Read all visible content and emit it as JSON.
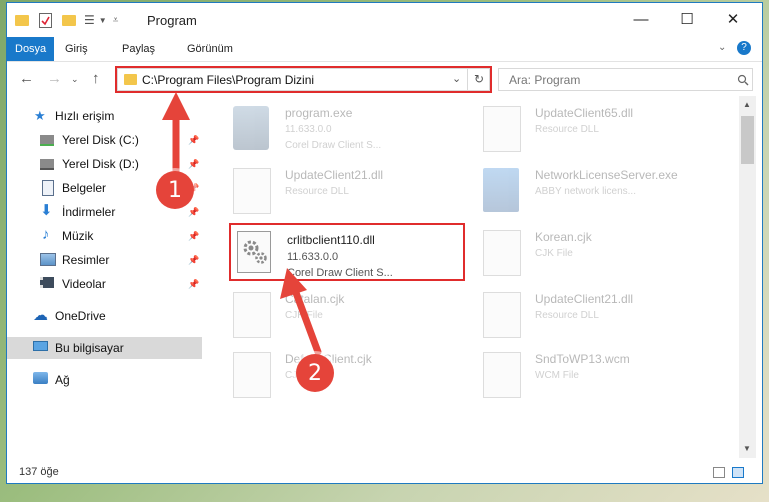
{
  "window": {
    "title": "Program",
    "controls": {
      "minimize": "—",
      "maximize": "☐",
      "close": "✕"
    }
  },
  "ribbon": {
    "tabs": [
      {
        "label": "Dosya",
        "active": true
      },
      {
        "label": "Giriş"
      },
      {
        "label": "Paylaş"
      },
      {
        "label": "Görünüm"
      }
    ],
    "accent": "#1979ca"
  },
  "address": {
    "path": "C:\\Program Files\\Program Dizini"
  },
  "search": {
    "placeholder": "Ara: Program"
  },
  "sidebar": {
    "items": [
      {
        "label": "Hızlı erişim",
        "icon": "star-icon"
      },
      {
        "label": "Yerel Disk (C:)",
        "icon": "drive-icon",
        "pinned": true
      },
      {
        "label": "Yerel Disk (D:)",
        "icon": "drive-icon",
        "pinned": true
      },
      {
        "label": "Belgeler",
        "icon": "documents-icon",
        "pinned": true
      },
      {
        "label": "İndirmeler",
        "icon": "download-icon",
        "pinned": true
      },
      {
        "label": "Müzik",
        "icon": "music-icon",
        "pinned": true
      },
      {
        "label": "Resimler",
        "icon": "pictures-icon",
        "pinned": true
      },
      {
        "label": "Videolar",
        "icon": "videos-icon",
        "pinned": true
      },
      {
        "label": "OneDrive",
        "icon": "cloud-icon"
      },
      {
        "label": "Bu bilgisayar",
        "icon": "computer-icon",
        "selected": true
      },
      {
        "label": "Ağ",
        "icon": "network-icon"
      }
    ]
  },
  "files": {
    "left": [
      {
        "name": "program.exe",
        "line1": "11.633.0.0",
        "line2": "Corel Draw Client S..."
      },
      {
        "name": "UpdateClient21.dll",
        "line1": "Resource DLL",
        "line2": ""
      },
      {
        "name": "crlitbclient110.dll",
        "line1": "11.633.0.0",
        "line2": "Corel Draw Client S...",
        "highlighted": true
      },
      {
        "name": "Catalan.cjk",
        "line1": "CJK File",
        "line2": ""
      },
      {
        "name": "DefaultClient.cjk",
        "line1": "CJK File",
        "line2": ""
      }
    ],
    "right": [
      {
        "name": "UpdateClient65.dll",
        "line1": "Resource DLL",
        "line2": ""
      },
      {
        "name": "NetworkLicenseServer.exe",
        "line1": "ABBY network licens...",
        "line2": ""
      },
      {
        "name": "Korean.cjk",
        "line1": "CJK File",
        "line2": ""
      },
      {
        "name": "UpdateClient21.dll",
        "line1": "Resource DLL",
        "line2": ""
      },
      {
        "name": "SndToWP13.wcm",
        "line1": "WCM File",
        "line2": ""
      }
    ]
  },
  "status": {
    "count": "137 öğe"
  },
  "annotations": {
    "step1": "1",
    "step2": "2",
    "color": "#e5443a"
  }
}
